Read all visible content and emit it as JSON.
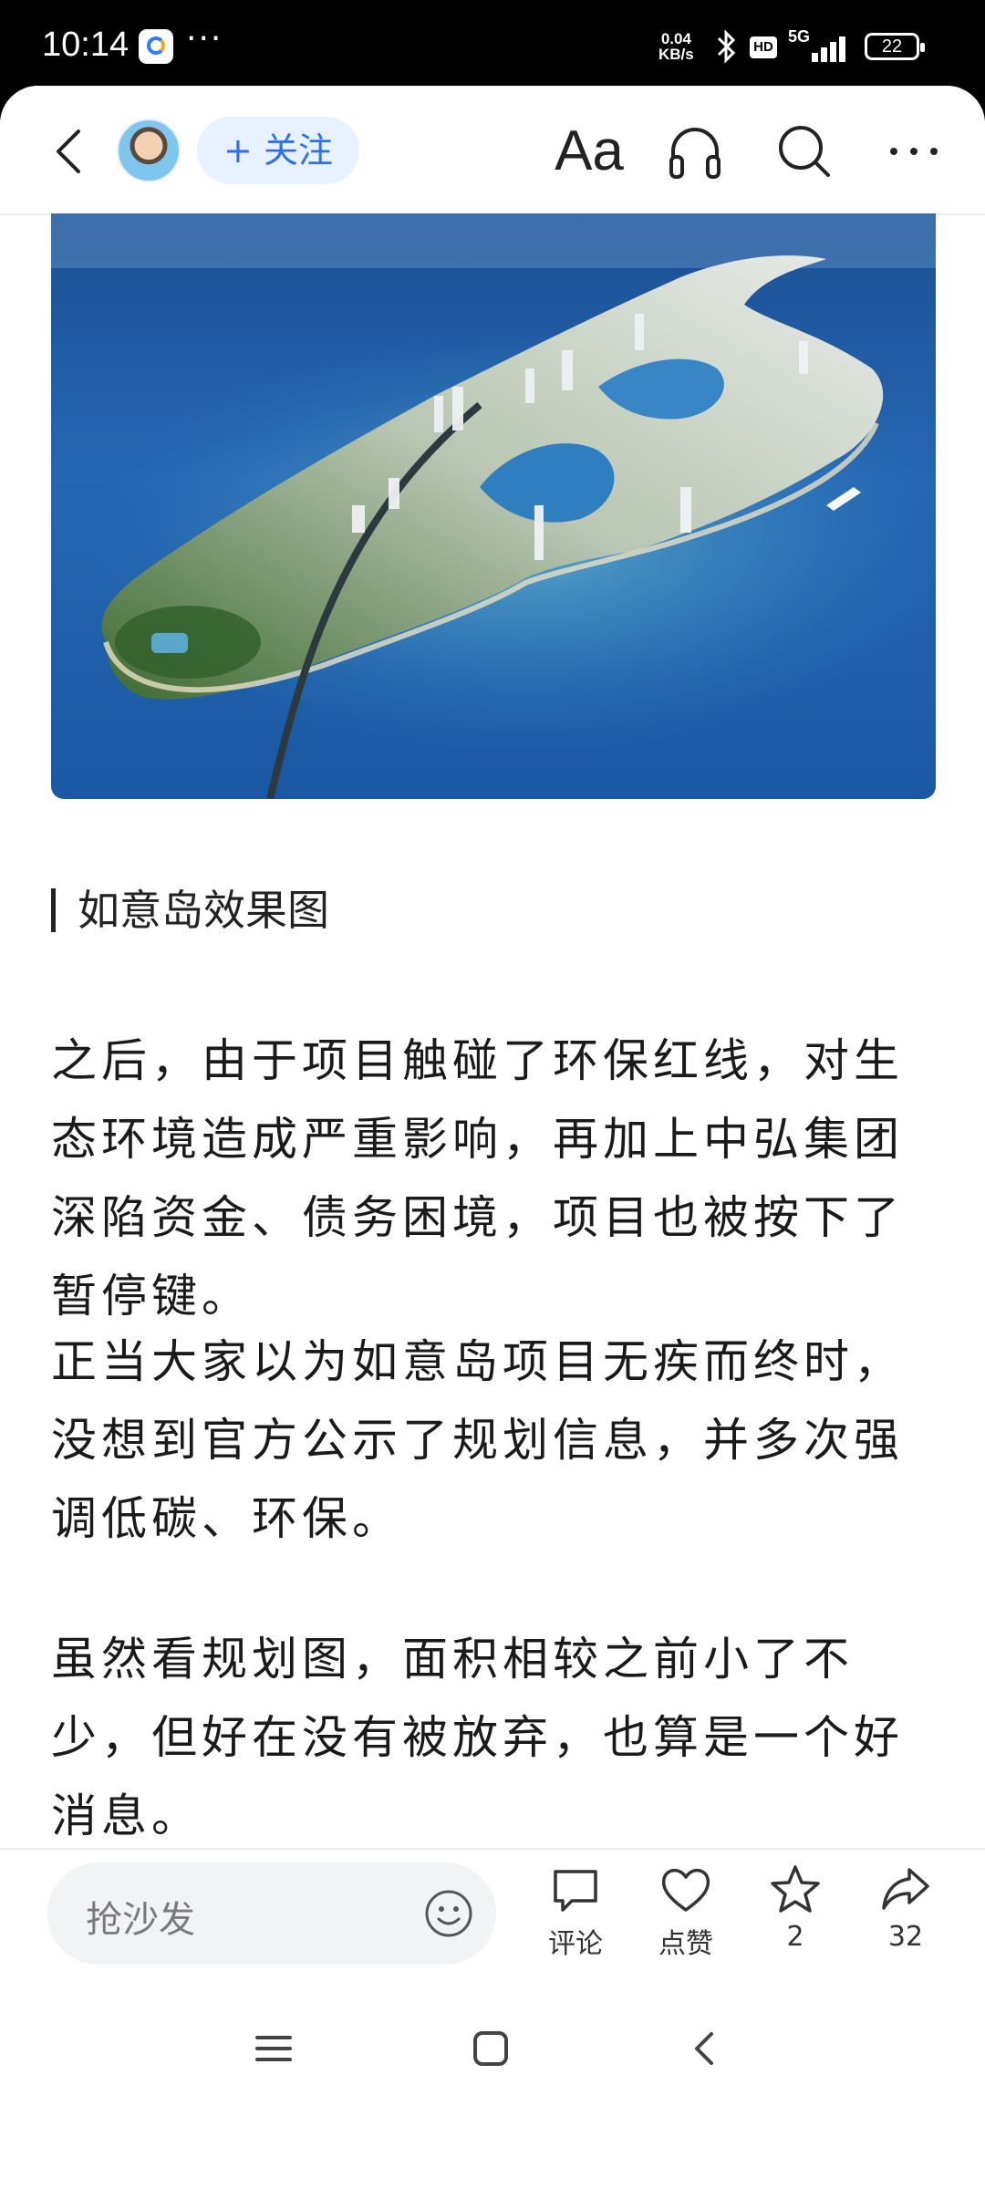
{
  "status_bar": {
    "time": "10:14",
    "more": "···",
    "net_speed_value": "0.04",
    "net_speed_unit": "KB/s",
    "hd": "HD",
    "network": "5G",
    "battery": "22"
  },
  "nav": {
    "follow_label": "+ 关注",
    "font_size_label": "Aa"
  },
  "article": {
    "image_caption": "如意岛效果图",
    "paragraphs": [
      "之后，由于项目触碰了环保红线，对生态环境造成严重影响，再加上中弘集团深陷资金、债务困境，项目也被按下了暂停键。",
      "正当大家以为如意岛项目无疾而终时，没想到官方公示了规划信息，并多次强调低碳、环保。",
      "虽然看规划图，面积相较之前小了不少，但好在没有被放弃，也算是一个好消息。"
    ]
  },
  "bottom_bar": {
    "comment_placeholder": "抢沙发",
    "comment_label": "评论",
    "like_label": "点赞",
    "favorite_count": "2",
    "share_count": "32"
  },
  "colors": {
    "accent": "#2f6ff2",
    "follow_bg": "#e8f1ff",
    "sea": "#1f5fa8"
  },
  "icons": [
    "back-icon",
    "font-size-icon",
    "headphones-icon",
    "search-icon",
    "more-icon",
    "emoji-icon",
    "comment-icon",
    "heart-icon",
    "star-icon",
    "share-icon",
    "menu-icon",
    "home-icon",
    "back-nav-icon"
  ]
}
